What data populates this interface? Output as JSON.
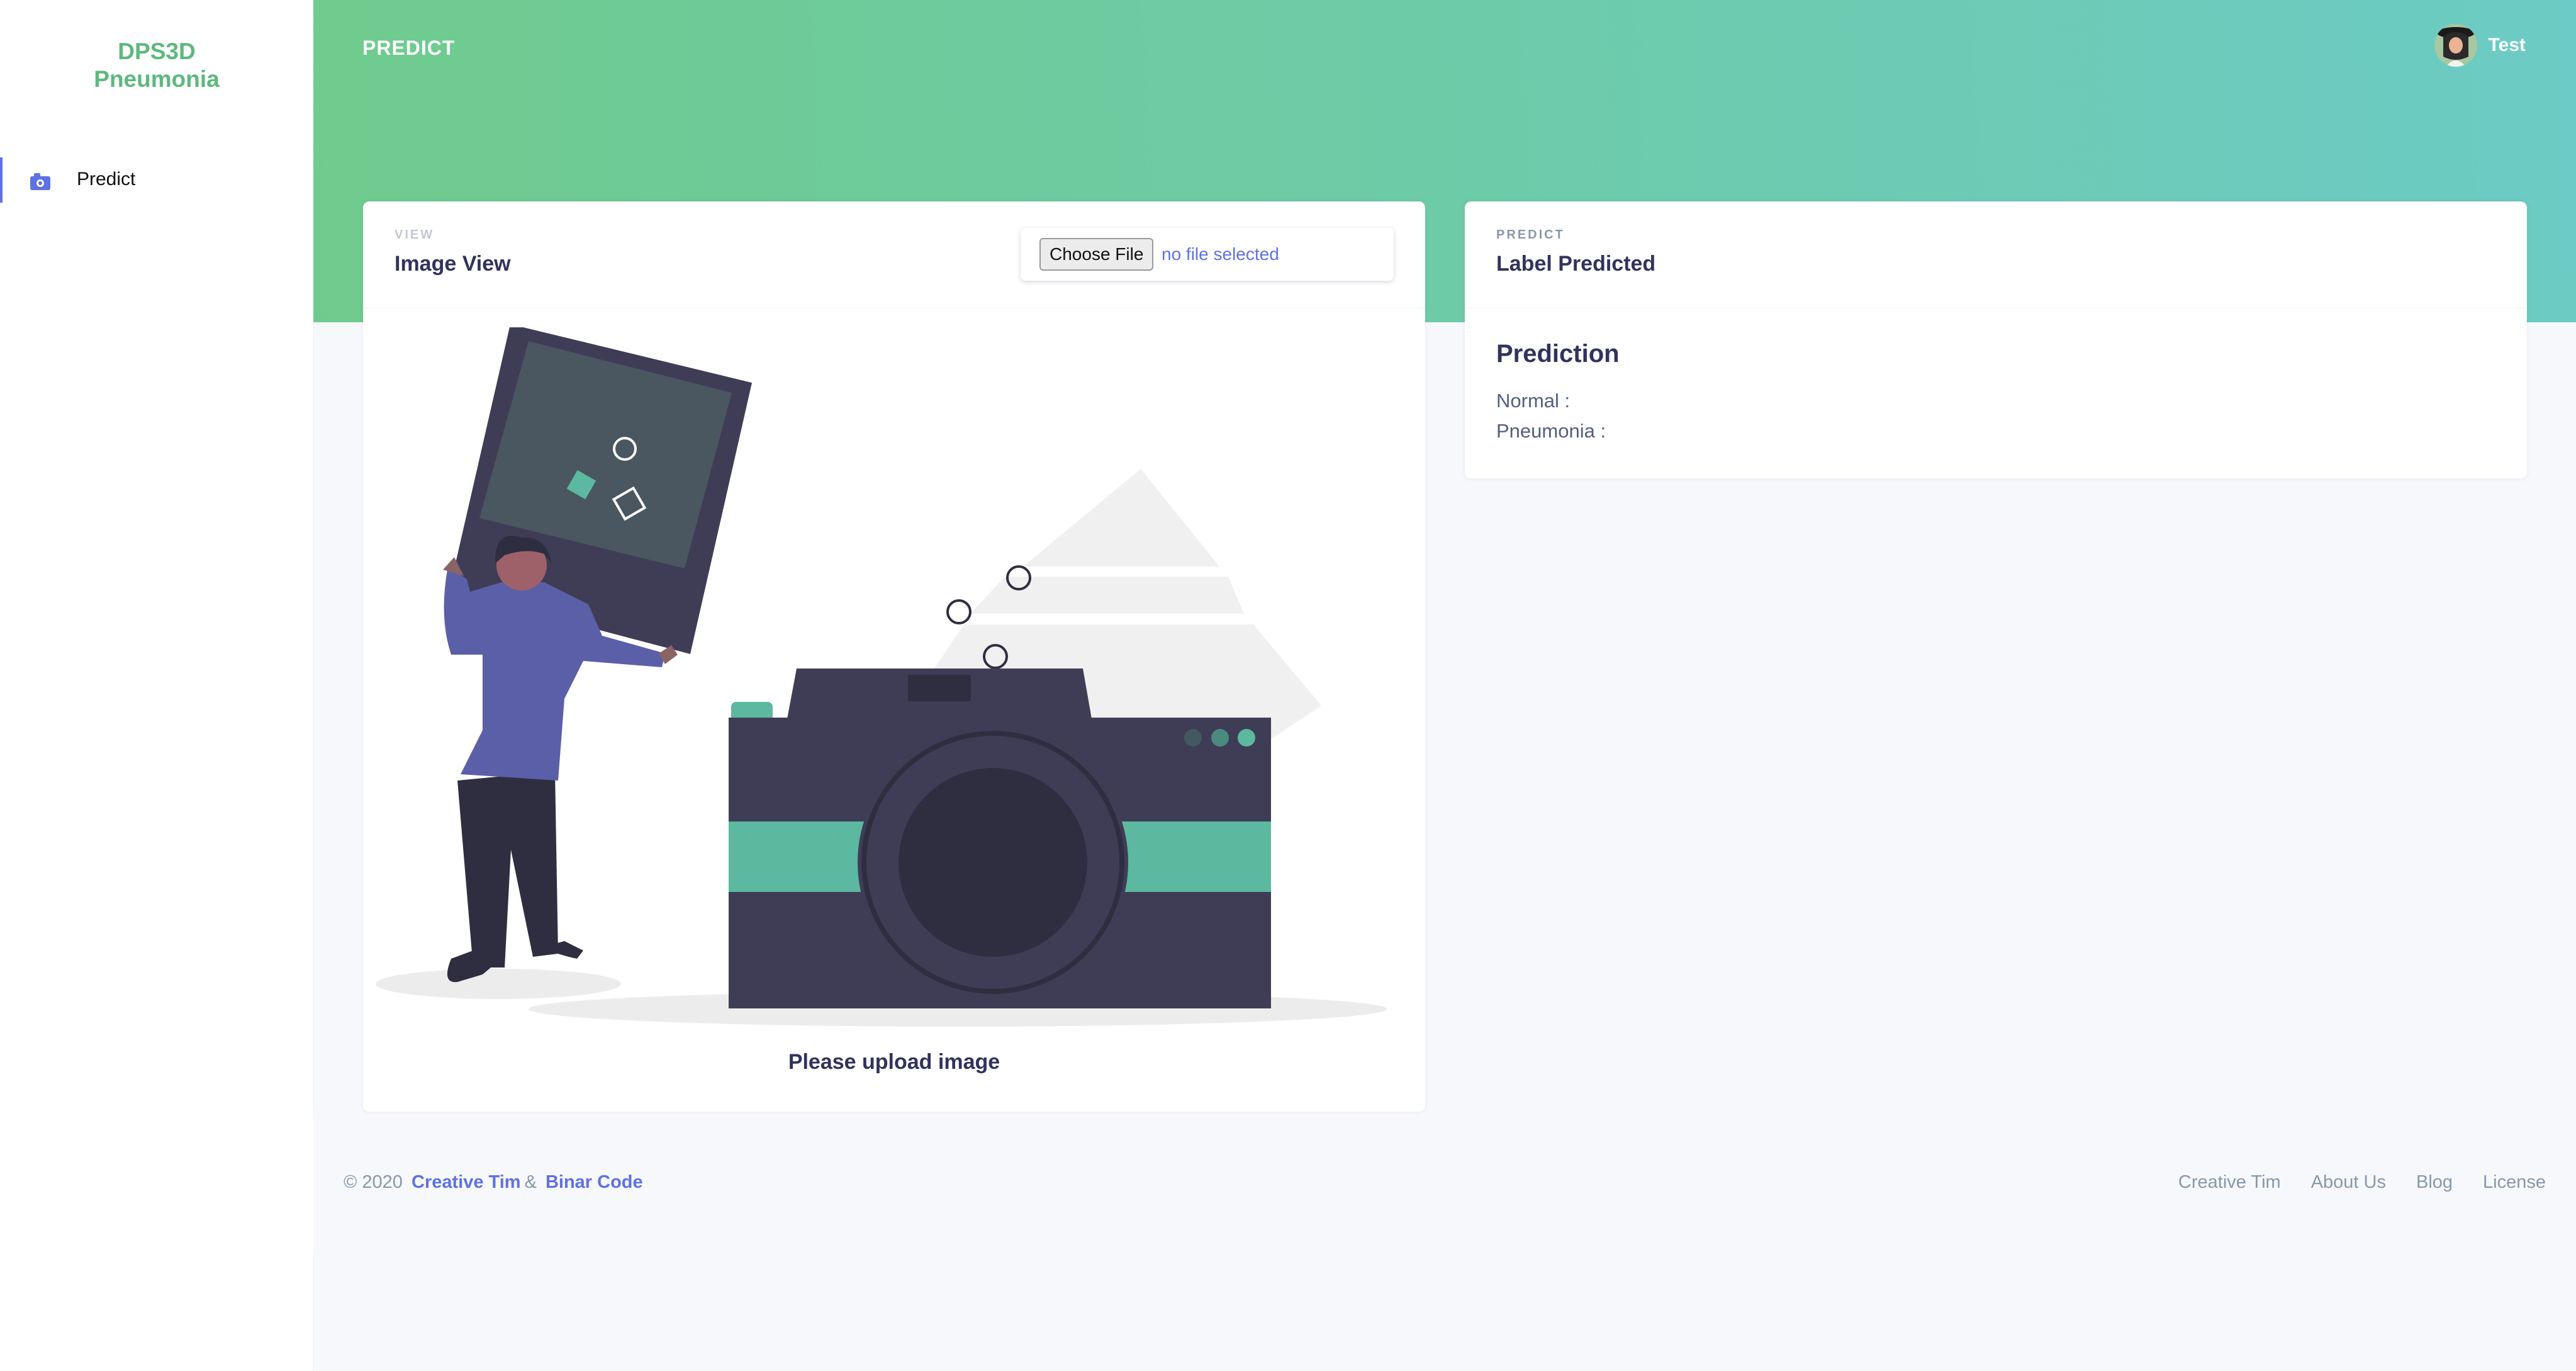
{
  "brand": {
    "line1": "DPS3D",
    "line2": "Pneumonia"
  },
  "sidebar": {
    "items": [
      {
        "label": "Predict",
        "icon": "camera-icon"
      }
    ]
  },
  "header": {
    "title": "PREDICT",
    "user_name": "Test"
  },
  "image_card": {
    "overline": "VIEW",
    "title": "Image View",
    "file_button_label": "Choose File",
    "file_status": "no file selected",
    "caption": "Please upload image"
  },
  "predict_card": {
    "overline": "PREDICT",
    "title": "Label Predicted",
    "section_title": "Prediction",
    "rows": [
      {
        "label": "Normal :"
      },
      {
        "label": "Pneumonia :"
      }
    ]
  },
  "footer": {
    "copyright_prefix": "© 2020",
    "link1": "Creative Tim",
    "amp": "&",
    "link2": "Binar Code",
    "links": [
      "Creative Tim",
      "About Us",
      "Blog",
      "License"
    ]
  },
  "colors": {
    "brand_green": "#5cb97c",
    "gradient_start": "#6fcb8d",
    "gradient_end": "#6ccbc4",
    "accent": "#5e72e4",
    "text_dark": "#32325d"
  }
}
